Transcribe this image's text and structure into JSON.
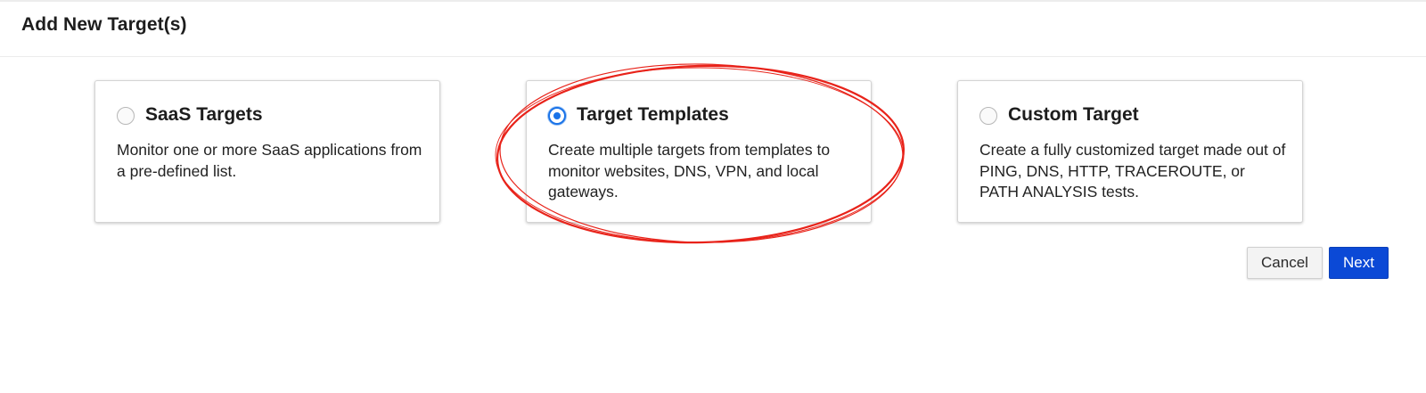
{
  "header": {
    "title": "Add New Target(s)"
  },
  "options": [
    {
      "title": "SaaS Targets",
      "description": "Monitor one or more SaaS applications from a pre-defined list.",
      "selected": false
    },
    {
      "title": "Target Templates",
      "description": "Create multiple targets from templates to monitor websites, DNS, VPN, and local gateways.",
      "selected": true
    },
    {
      "title": "Custom Target",
      "description": "Create a fully customized target made out of PING, DNS, HTTP, TRACEROUTE, or PATH ANALYSIS tests.",
      "selected": false
    }
  ],
  "footer": {
    "cancel_label": "Cancel",
    "next_label": "Next"
  },
  "colors": {
    "accent": "#1a73e8",
    "primary_button": "#0b49d6",
    "annotation": "#e8231a"
  }
}
